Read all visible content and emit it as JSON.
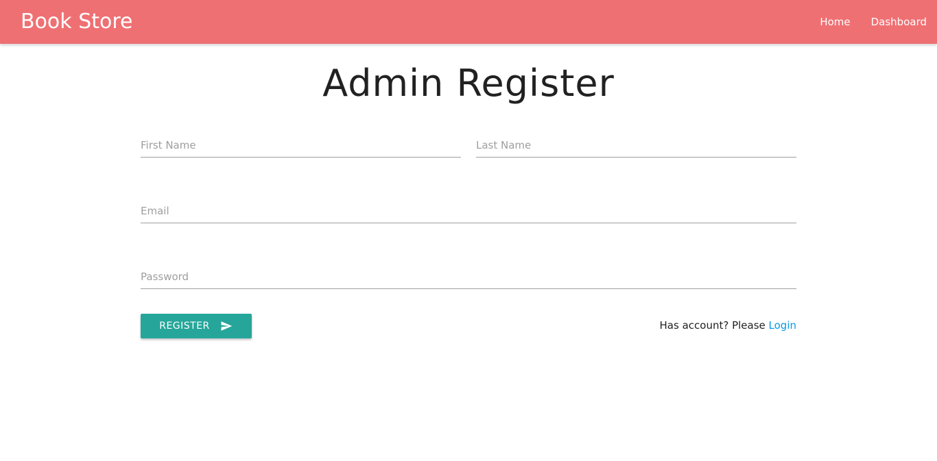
{
  "navbar": {
    "brand": "Book Store",
    "links": [
      {
        "label": "Home"
      },
      {
        "label": "Dashboard"
      }
    ],
    "background_color": "#ef7073"
  },
  "page_title": "Admin Register",
  "form": {
    "first_name": {
      "placeholder": "First Name",
      "value": ""
    },
    "last_name": {
      "placeholder": "Last Name",
      "value": ""
    },
    "email": {
      "placeholder": "Email",
      "value": ""
    },
    "password": {
      "placeholder": "Password",
      "value": ""
    },
    "register_button": {
      "label": "REGISTER",
      "icon": "send-icon",
      "color": "#26a69a"
    }
  },
  "login_prompt": {
    "text": "Has account? Please ",
    "link_label": "Login",
    "link_color": "#039be5"
  }
}
